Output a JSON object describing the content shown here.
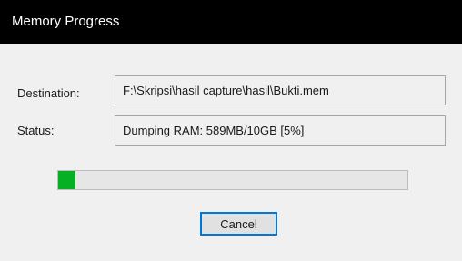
{
  "window": {
    "title": "Memory Progress"
  },
  "destination": {
    "label": "Destination:",
    "value": "F:\\Skripsi\\hasil capture\\hasil\\Bukti.mem"
  },
  "status": {
    "label": "Status:",
    "value": "Dumping RAM: 589MB/10GB [5%]"
  },
  "progress": {
    "fraction": 0.05,
    "color": "#06b025"
  },
  "buttons": {
    "cancel_label": "Cancel"
  },
  "colors": {
    "titlebar": "#000000",
    "accent": "#0078d7"
  }
}
